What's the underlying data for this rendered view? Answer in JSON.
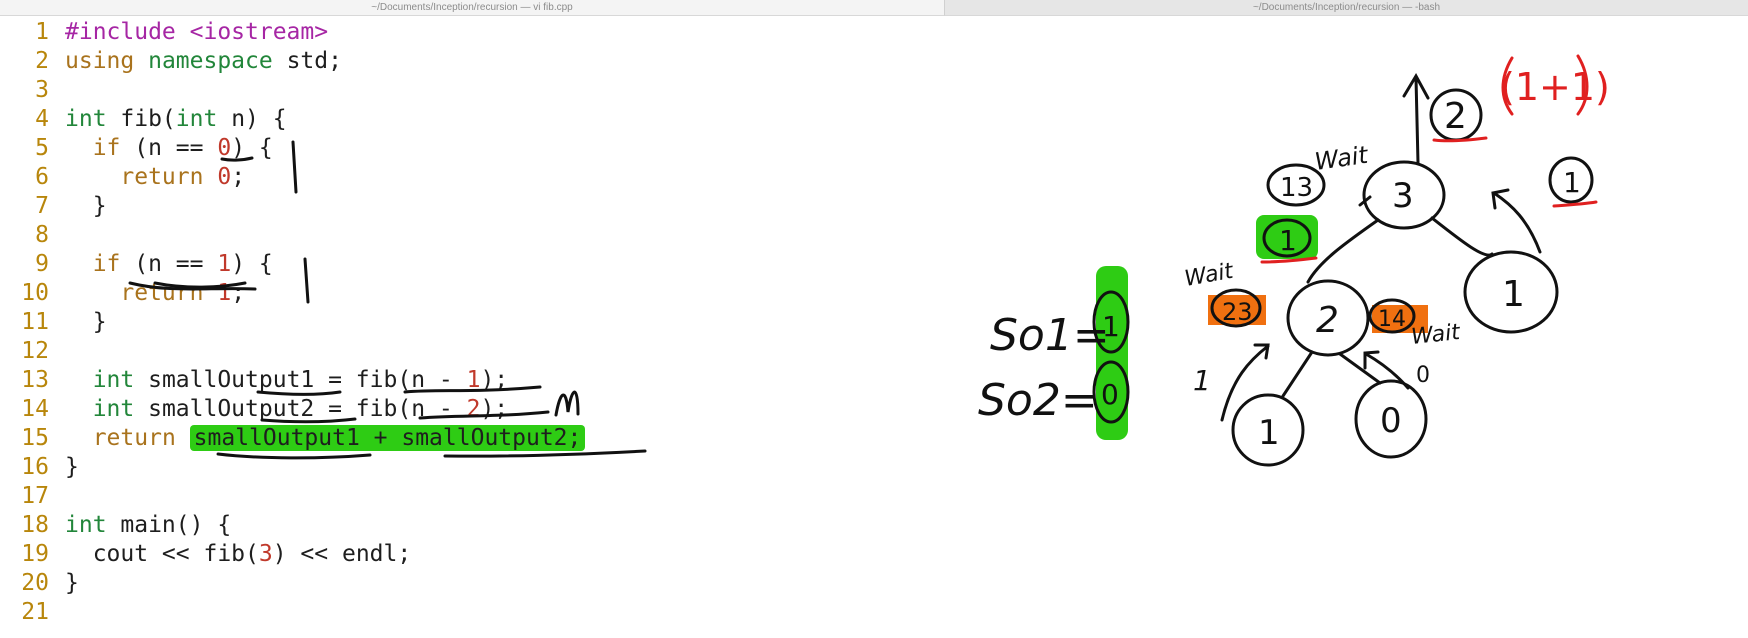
{
  "window": {
    "left_title": "~/Documents/Inception/recursion — vi fib.cpp",
    "right_title": "~/Documents/Inception/recursion — -bash"
  },
  "editor": {
    "lines": [
      {
        "n": "1",
        "segs": [
          {
            "t": "#include <iostream>",
            "c": "kw-pp"
          }
        ]
      },
      {
        "n": "2",
        "segs": [
          {
            "t": "using ",
            "c": "kw-r"
          },
          {
            "t": "namespace",
            "c": "kw"
          },
          {
            "t": " std;",
            "c": ""
          }
        ]
      },
      {
        "n": "3",
        "segs": []
      },
      {
        "n": "4",
        "segs": [
          {
            "t": "int",
            "c": "kw"
          },
          {
            "t": " fib(",
            "c": ""
          },
          {
            "t": "int",
            "c": "kw"
          },
          {
            "t": " n) {",
            "c": ""
          }
        ]
      },
      {
        "n": "5",
        "segs": [
          {
            "t": "  ",
            "c": ""
          },
          {
            "t": "if",
            "c": "kw-r"
          },
          {
            "t": " (n == ",
            "c": ""
          },
          {
            "t": "0",
            "c": "num"
          },
          {
            "t": ") {",
            "c": ""
          }
        ]
      },
      {
        "n": "6",
        "segs": [
          {
            "t": "    ",
            "c": ""
          },
          {
            "t": "return",
            "c": "kw-r"
          },
          {
            "t": " ",
            "c": ""
          },
          {
            "t": "0",
            "c": "num"
          },
          {
            "t": ";",
            "c": ""
          }
        ]
      },
      {
        "n": "7",
        "segs": [
          {
            "t": "  }",
            "c": ""
          }
        ]
      },
      {
        "n": "8",
        "segs": []
      },
      {
        "n": "9",
        "segs": [
          {
            "t": "  ",
            "c": ""
          },
          {
            "t": "if",
            "c": "kw-r"
          },
          {
            "t": " (n == ",
            "c": ""
          },
          {
            "t": "1",
            "c": "num"
          },
          {
            "t": ") {",
            "c": ""
          }
        ]
      },
      {
        "n": "10",
        "segs": [
          {
            "t": "    ",
            "c": ""
          },
          {
            "t": "return",
            "c": "kw-r"
          },
          {
            "t": " ",
            "c": ""
          },
          {
            "t": "1",
            "c": "num"
          },
          {
            "t": ";",
            "c": ""
          }
        ]
      },
      {
        "n": "11",
        "segs": [
          {
            "t": "  }",
            "c": ""
          }
        ]
      },
      {
        "n": "12",
        "segs": []
      },
      {
        "n": "13",
        "segs": [
          {
            "t": "  ",
            "c": ""
          },
          {
            "t": "int",
            "c": "kw"
          },
          {
            "t": " smallOutput1 = fib(n - ",
            "c": ""
          },
          {
            "t": "1",
            "c": "num"
          },
          {
            "t": ");",
            "c": ""
          }
        ]
      },
      {
        "n": "14",
        "segs": [
          {
            "t": "  ",
            "c": ""
          },
          {
            "t": "int",
            "c": "kw"
          },
          {
            "t": " smallOutput2 = fib(n - ",
            "c": ""
          },
          {
            "t": "2",
            "c": "num"
          },
          {
            "t": ");",
            "c": ""
          }
        ]
      },
      {
        "n": "15",
        "segs": [
          {
            "t": "  ",
            "c": ""
          },
          {
            "t": "return",
            "c": "kw-r"
          },
          {
            "t": " ",
            "c": ""
          },
          {
            "t": "smallOutput1 + smallOutput2;",
            "c": "hl"
          }
        ]
      },
      {
        "n": "16",
        "segs": [
          {
            "t": "}",
            "c": ""
          }
        ]
      },
      {
        "n": "17",
        "segs": []
      },
      {
        "n": "18",
        "segs": [
          {
            "t": "int",
            "c": "kw"
          },
          {
            "t": " main() {",
            "c": ""
          }
        ]
      },
      {
        "n": "19",
        "segs": [
          {
            "t": "  cout << fib(",
            "c": ""
          },
          {
            "t": "3",
            "c": "num"
          },
          {
            "t": ") << endl;",
            "c": ""
          }
        ]
      },
      {
        "n": "20",
        "segs": [
          {
            "t": "}",
            "c": ""
          }
        ]
      },
      {
        "n": "21",
        "segs": []
      }
    ]
  },
  "annotations": {
    "so1_label": "So1=",
    "so1_value": "1",
    "so2_label": "So2=",
    "so2_value": "0",
    "wait_1": "Wait",
    "wait_2": "Wait",
    "wait_3": "Wait",
    "formula": "(1+1)",
    "result_top": "2",
    "node_root": "3",
    "node_left": "2",
    "node_right": "1",
    "node_ll": "1",
    "node_lr": "0",
    "badge_13": "13",
    "badge_green_1": "1",
    "badge_23": "23",
    "badge_14": "14",
    "return_right": "1",
    "edge_label_1": "1",
    "edge_label_0": "0",
    "colors": {
      "ink": "#111111",
      "highlight_green": "#2ecc14",
      "orange": "#f07010",
      "red": "#e02020"
    }
  }
}
